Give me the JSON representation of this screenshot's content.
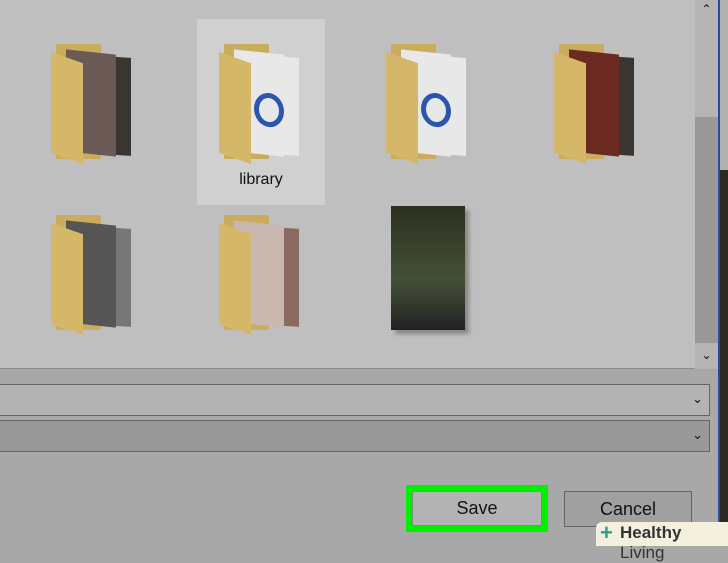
{
  "files": [
    {
      "name": "",
      "type": "folder-photos"
    },
    {
      "name": "library",
      "type": "folder-documents",
      "selected": true
    },
    {
      "name": "",
      "type": "folder-documents"
    },
    {
      "name": "",
      "type": "folder-photos"
    },
    {
      "name": "",
      "type": "folder-photos"
    },
    {
      "name": "",
      "type": "folder-photos"
    },
    {
      "name": "",
      "type": "photo"
    }
  ],
  "scrollbar": {
    "up": "⌃",
    "down": "⌄"
  },
  "dropdowns": {
    "chevron": "⌄"
  },
  "buttons": {
    "save": "Save",
    "cancel": "Cancel"
  },
  "highlight_color": "#00f000",
  "watermark": {
    "brand": "Healthy",
    "suffix": " Living",
    "icon": "+"
  }
}
